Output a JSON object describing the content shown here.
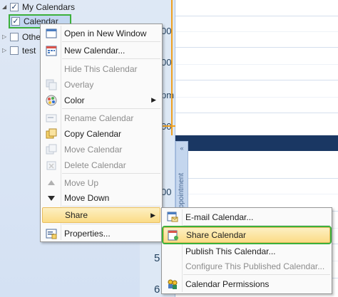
{
  "nav": {
    "group_label": "My Calendars",
    "items": [
      {
        "label": "Calendar",
        "checked": true
      },
      {
        "label": "Othe",
        "checked": false
      },
      {
        "label": "test",
        "checked": false
      }
    ]
  },
  "grid": {
    "time_labels": [
      "00",
      "00",
      "pm",
      "00",
      "00",
      "00",
      "5",
      "6"
    ],
    "appointment_strip_label": "Appointment",
    "collapse_glyph": "«"
  },
  "context_menu": {
    "items": [
      {
        "label": "Open in New Window",
        "icon": "open-window-icon",
        "enabled": true
      },
      {
        "label": "New Calendar...",
        "icon": "new-calendar-icon",
        "enabled": true
      },
      {
        "label": "Hide This Calendar",
        "icon": "",
        "enabled": false
      },
      {
        "label": "Overlay",
        "icon": "overlay-icon",
        "enabled": false
      },
      {
        "label": "Color",
        "icon": "color-icon",
        "enabled": true,
        "submenu": true
      },
      {
        "label": "Rename Calendar",
        "icon": "rename-icon",
        "enabled": false
      },
      {
        "label": "Copy Calendar",
        "icon": "copy-icon",
        "enabled": true
      },
      {
        "label": "Move Calendar",
        "icon": "move-icon",
        "enabled": false
      },
      {
        "label": "Delete Calendar",
        "icon": "delete-icon",
        "enabled": false
      },
      {
        "label": "Move Up",
        "icon": "up-arrow-icon",
        "enabled": false
      },
      {
        "label": "Move Down",
        "icon": "down-arrow-icon",
        "enabled": true
      },
      {
        "label": "Share",
        "icon": "",
        "enabled": true,
        "submenu": true,
        "highlighted": true
      },
      {
        "label": "Properties...",
        "icon": "properties-icon",
        "enabled": true
      }
    ]
  },
  "share_submenu": {
    "items": [
      {
        "label": "E-mail Calendar...",
        "icon": "email-calendar-icon",
        "enabled": true
      },
      {
        "label": "Share Calendar",
        "icon": "share-calendar-icon",
        "enabled": true,
        "highlighted": true
      },
      {
        "label": "Publish This Calendar...",
        "icon": "",
        "enabled": true
      },
      {
        "label": "Configure This Published Calendar...",
        "icon": "",
        "enabled": false
      },
      {
        "label": "Calendar Permissions",
        "icon": "permissions-icon",
        "enabled": true
      }
    ]
  },
  "colors": {
    "highlight_green": "#3cb03c",
    "menu_highlight": "#fbdc86",
    "allday_bar": "#1a3763",
    "now_line": "#f0a020"
  }
}
